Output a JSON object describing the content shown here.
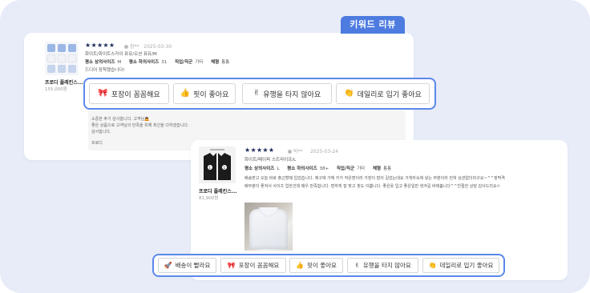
{
  "badge": "키워드 리뷰",
  "back_review": {
    "product_name": "프로디 플레킨스...",
    "product_price": "155,000원",
    "stars": "★★★★★",
    "user": "장**",
    "date": "2025-03-30",
    "option": "화이트/화이트스카이 퓨유/오션 퓨유/M",
    "specs": [
      {
        "k": "평소 상의사이즈",
        "v": "M"
      },
      {
        "k": "평소 하의사이즈",
        "v": "31"
      },
      {
        "k": "직업/직군",
        "v": "기타"
      },
      {
        "k": "체형",
        "v": "통통"
      }
    ],
    "body": "드디어 장착했습니다!",
    "reply": [
      "소중한 후기 감사합니다. 고객님🙇",
      "좋은 상품으로 고객님의 만족을 위해 최선을 다하겠습니다.",
      "감사합니다.",
      "",
      "프로디"
    ]
  },
  "back_keywords": [
    {
      "icon": "🎀",
      "icon_name": "ribbon-icon",
      "label": "포장이 꼼꼼해요"
    },
    {
      "icon": "👍",
      "icon_name": "thumbs-up-icon",
      "label": "핏이 좋아요"
    },
    {
      "icon": "✌",
      "icon_name": "victory-hand-icon",
      "label": "유행을 타지 않아요"
    },
    {
      "icon": "👏",
      "icon_name": "clapping-hands-icon",
      "label": "데일리로 입기 좋아요"
    }
  ],
  "front_review": {
    "product_name": "프로디 플레킨스...",
    "product_price": "81,900원",
    "stars": "★★★★★",
    "user": "박**",
    "date": "2025-03-24",
    "option": "화이트/페이퍼 스트라이프/L",
    "specs": [
      {
        "k": "평소 상의사이즈",
        "v": "L"
      },
      {
        "k": "평소 하의사이즈",
        "v": "38+"
      },
      {
        "k": "직업/직군",
        "v": "기타"
      },
      {
        "k": "체형",
        "v": "통통"
      }
    ],
    "body_line1": "배송받고 오늘 바로 출근할때 입었습니다. 제구에 가께 키가 작은편이라 가장이 많이 길었는데요 가게자속에 넣는 부분이라 전혀 상관없더라구요~^^핏딱격",
    "body_line2": "배부분이 좋져서 사이즈 업한건데 매우 만족합니다. 편하게 잘 맞고 핏도 이쁩니다. 좋은옷 입고 좋은일만 생겨길 바래봅니다^^친절한 상담 감사드리요ㅇ"
  },
  "front_keywords": [
    {
      "icon": "🚀",
      "icon_name": "rocket-icon",
      "label": "배송이 빨라요"
    },
    {
      "icon": "🎀",
      "icon_name": "ribbon-icon",
      "label": "포장이 꼼꼼해요"
    },
    {
      "icon": "👍",
      "icon_name": "thumbs-up-icon",
      "label": "핏이 좋아요"
    },
    {
      "icon": "✌",
      "icon_name": "victory-hand-icon",
      "label": "유행을 타지 않아요"
    },
    {
      "icon": "👏",
      "icon_name": "clapping-hands-icon",
      "label": "데일리로 입기 좋아요"
    }
  ],
  "colors": {
    "accent": "#4d7be0",
    "frame": "#5b88ea",
    "background": "#e7ecf8",
    "star": "#1c2b5a"
  }
}
